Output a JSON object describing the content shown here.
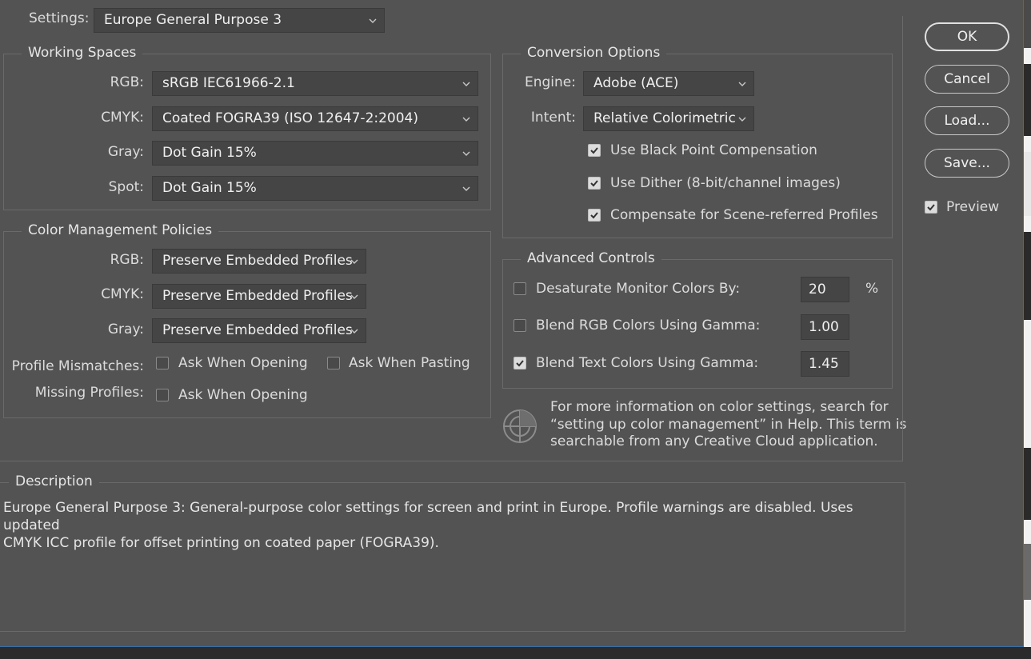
{
  "settings": {
    "label": "Settings:",
    "value": "Europe General Purpose 3"
  },
  "working_spaces": {
    "title": "Working Spaces",
    "rgb": {
      "label": "RGB:",
      "value": "sRGB IEC61966-2.1"
    },
    "cmyk": {
      "label": "CMYK:",
      "value": "Coated FOGRA39 (ISO 12647-2:2004)"
    },
    "gray": {
      "label": "Gray:",
      "value": "Dot Gain 15%"
    },
    "spot": {
      "label": "Spot:",
      "value": "Dot Gain 15%"
    }
  },
  "policies": {
    "title": "Color Management Policies",
    "rgb": {
      "label": "RGB:",
      "value": "Preserve Embedded Profiles"
    },
    "cmyk": {
      "label": "CMYK:",
      "value": "Preserve Embedded Profiles"
    },
    "gray": {
      "label": "Gray:",
      "value": "Preserve Embedded Profiles"
    },
    "mismatch_label": "Profile Mismatches:",
    "mismatch_opening": {
      "label": "Ask When Opening",
      "checked": false
    },
    "mismatch_pasting": {
      "label": "Ask When Pasting",
      "checked": false
    },
    "missing_label": "Missing Profiles:",
    "missing_opening": {
      "label": "Ask When Opening",
      "checked": false
    }
  },
  "conversion": {
    "title": "Conversion Options",
    "engine": {
      "label": "Engine:",
      "value": "Adobe (ACE)"
    },
    "intent": {
      "label": "Intent:",
      "value": "Relative Colorimetric"
    },
    "black_point": {
      "label": "Use Black Point Compensation",
      "checked": true
    },
    "dither": {
      "label": "Use Dither (8-bit/channel images)",
      "checked": true
    },
    "scene_referred": {
      "label": "Compensate for Scene-referred Profiles",
      "checked": true
    }
  },
  "advanced": {
    "title": "Advanced Controls",
    "desaturate": {
      "label": "Desaturate Monitor Colors By:",
      "value": "20",
      "unit": "%",
      "checked": false
    },
    "blend_rgb": {
      "label": "Blend RGB Colors Using Gamma:",
      "value": "1.00",
      "checked": false
    },
    "blend_text": {
      "label": "Blend Text Colors Using Gamma:",
      "value": "1.45",
      "checked": true
    }
  },
  "info": {
    "line1": "For more information on color settings, search for",
    "line2": "“setting up color management” in Help. This term is",
    "line3": "searchable from any Creative Cloud application."
  },
  "description": {
    "title": "Description",
    "line1": "Europe General Purpose 3:  General-purpose color settings for screen and print in Europe. Profile warnings are disabled. Uses updated",
    "line2": "CMYK ICC profile for offset printing on coated paper (FOGRA39)."
  },
  "buttons": {
    "ok": "OK",
    "cancel": "Cancel",
    "load": "Load...",
    "save": "Save..."
  },
  "preview": {
    "label": "Preview",
    "checked": true
  },
  "colors": {
    "dialog_bg": "#535353",
    "field_bg": "#454545",
    "accent_border": "#3a6ea5"
  }
}
